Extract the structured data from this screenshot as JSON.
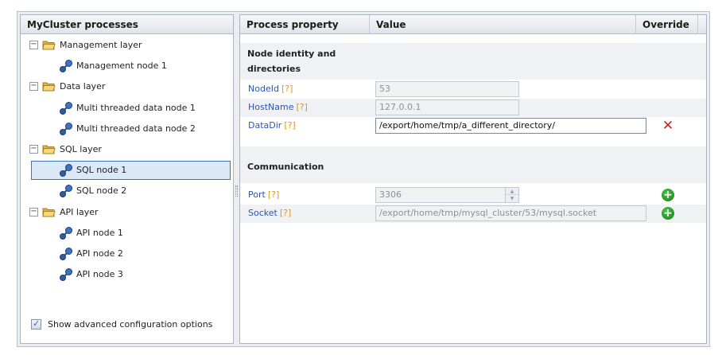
{
  "tree_panel": {
    "title": "MyCluster processes",
    "groups": [
      {
        "label": "Management layer",
        "nodes": [
          "Management node 1"
        ]
      },
      {
        "label": "Data layer",
        "nodes": [
          "Multi threaded data node 1",
          "Multi threaded data node 2"
        ]
      },
      {
        "label": "SQL layer",
        "nodes": [
          "SQL node 1",
          "SQL node 2"
        ]
      },
      {
        "label": "API layer",
        "nodes": [
          "API node 1",
          "API node 2",
          "API node 3"
        ]
      }
    ],
    "selected_node": "SQL node 1",
    "advanced_option": {
      "label": "Show advanced configuration options",
      "checked": true
    }
  },
  "property_grid": {
    "columns": {
      "property": "Process property",
      "value": "Value",
      "override": "Override"
    },
    "help_marker": "[?]",
    "sections": [
      {
        "title_line1": "Node identity and",
        "title_line2": "directories",
        "rows": [
          {
            "name": "NodeId",
            "value": "53",
            "editable": false,
            "override_icon": null
          },
          {
            "name": "HostName",
            "value": "127.0.0.1",
            "editable": false,
            "override_icon": null
          },
          {
            "name": "DataDir",
            "value": "/export/home/tmp/a_different_directory/",
            "editable": true,
            "override_icon": "remove-icon"
          }
        ]
      },
      {
        "title_line1": "Communication",
        "rows": [
          {
            "name": "Port",
            "value": "3306",
            "editable": false,
            "override_icon": "add-icon"
          },
          {
            "name": "Socket",
            "value": "/export/home/tmp/mysql_cluster/53/mysql.socket",
            "editable": false,
            "override_icon": "add-icon"
          }
        ]
      }
    ]
  },
  "colors": {
    "property_name": "#2a55b8",
    "help_marker": "#d99a1a",
    "remove": "#cc1f1f",
    "add": "#1f9a1c",
    "selection_border": "#3d74b8"
  }
}
